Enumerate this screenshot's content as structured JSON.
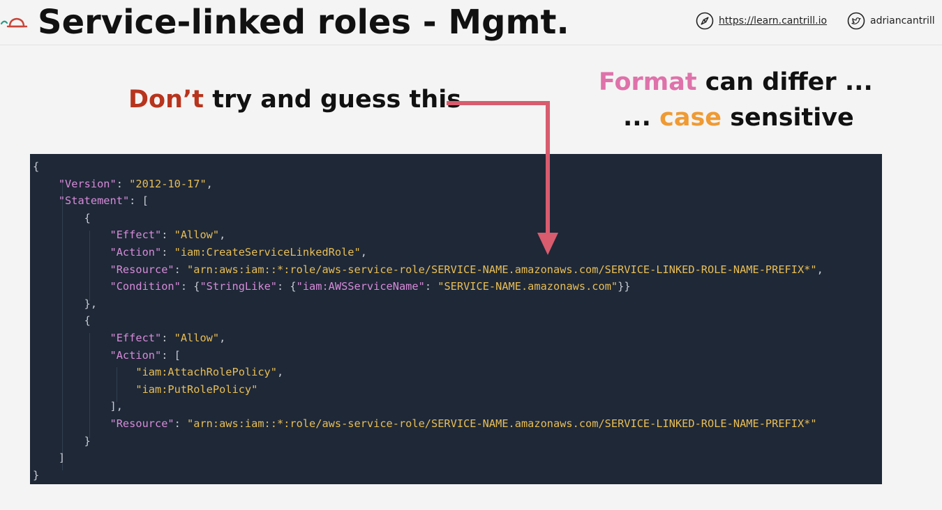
{
  "header": {
    "title": "Service-linked roles - Mgmt.",
    "website": "https://learn.cantrill.io",
    "twitter": "adriancantrill"
  },
  "callouts": {
    "left": {
      "highlight": "Don’t",
      "rest": " try and guess this"
    },
    "right_line1": {
      "highlight": "Format",
      "rest": " can differ ..."
    },
    "right_line2": {
      "prefix": "... ",
      "highlight": "case",
      "rest": " sensitive"
    }
  },
  "colors": {
    "red": "#b8341d",
    "pink": "#df72aa",
    "orange": "#ef9a33",
    "arrow": "#d85c6e",
    "code_bg": "#1e2837",
    "code_key": "#d78bd9",
    "code_string": "#e9be55"
  },
  "code": {
    "lines": [
      [
        {
          "t": "p",
          "v": "{"
        }
      ],
      [
        {
          "t": "p",
          "v": "    "
        },
        {
          "t": "k",
          "v": "\"Version\""
        },
        {
          "t": "p",
          "v": ": "
        },
        {
          "t": "s",
          "v": "\"2012-10-17\""
        },
        {
          "t": "p",
          "v": ","
        }
      ],
      [
        {
          "t": "p",
          "v": "    "
        },
        {
          "t": "k",
          "v": "\"Statement\""
        },
        {
          "t": "p",
          "v": ": ["
        }
      ],
      [
        {
          "t": "p",
          "v": "        {"
        }
      ],
      [
        {
          "t": "p",
          "v": "            "
        },
        {
          "t": "k",
          "v": "\"Effect\""
        },
        {
          "t": "p",
          "v": ": "
        },
        {
          "t": "s",
          "v": "\"Allow\""
        },
        {
          "t": "p",
          "v": ","
        }
      ],
      [
        {
          "t": "p",
          "v": "            "
        },
        {
          "t": "k",
          "v": "\"Action\""
        },
        {
          "t": "p",
          "v": ": "
        },
        {
          "t": "s",
          "v": "\"iam:CreateServiceLinkedRole\""
        },
        {
          "t": "p",
          "v": ","
        }
      ],
      [
        {
          "t": "p",
          "v": "            "
        },
        {
          "t": "k",
          "v": "\"Resource\""
        },
        {
          "t": "p",
          "v": ": "
        },
        {
          "t": "s",
          "v": "\"arn:aws:iam::*:role/aws-service-role/SERVICE-NAME.amazonaws.com/SERVICE-LINKED-ROLE-NAME-PREFIX*\""
        },
        {
          "t": "p",
          "v": ","
        }
      ],
      [
        {
          "t": "p",
          "v": "            "
        },
        {
          "t": "k",
          "v": "\"Condition\""
        },
        {
          "t": "p",
          "v": ": {"
        },
        {
          "t": "k",
          "v": "\"StringLike\""
        },
        {
          "t": "p",
          "v": ": {"
        },
        {
          "t": "k",
          "v": "\"iam:AWSServiceName\""
        },
        {
          "t": "p",
          "v": ": "
        },
        {
          "t": "s",
          "v": "\"SERVICE-NAME.amazonaws.com\""
        },
        {
          "t": "p",
          "v": "}}"
        }
      ],
      [
        {
          "t": "p",
          "v": "        },"
        }
      ],
      [
        {
          "t": "p",
          "v": "        {"
        }
      ],
      [
        {
          "t": "p",
          "v": "            "
        },
        {
          "t": "k",
          "v": "\"Effect\""
        },
        {
          "t": "p",
          "v": ": "
        },
        {
          "t": "s",
          "v": "\"Allow\""
        },
        {
          "t": "p",
          "v": ","
        }
      ],
      [
        {
          "t": "p",
          "v": "            "
        },
        {
          "t": "k",
          "v": "\"Action\""
        },
        {
          "t": "p",
          "v": ": ["
        }
      ],
      [
        {
          "t": "p",
          "v": "                "
        },
        {
          "t": "s",
          "v": "\"iam:AttachRolePolicy\""
        },
        {
          "t": "p",
          "v": ","
        }
      ],
      [
        {
          "t": "p",
          "v": "                "
        },
        {
          "t": "s",
          "v": "\"iam:PutRolePolicy\""
        }
      ],
      [
        {
          "t": "p",
          "v": "            ],"
        }
      ],
      [
        {
          "t": "p",
          "v": "            "
        },
        {
          "t": "k",
          "v": "\"Resource\""
        },
        {
          "t": "p",
          "v": ": "
        },
        {
          "t": "s",
          "v": "\"arn:aws:iam::*:role/aws-service-role/SERVICE-NAME.amazonaws.com/SERVICE-LINKED-ROLE-NAME-PREFIX*\""
        }
      ],
      [
        {
          "t": "p",
          "v": "        }"
        }
      ],
      [
        {
          "t": "p",
          "v": "    ]"
        }
      ],
      [
        {
          "t": "p",
          "v": "}"
        }
      ]
    ]
  }
}
